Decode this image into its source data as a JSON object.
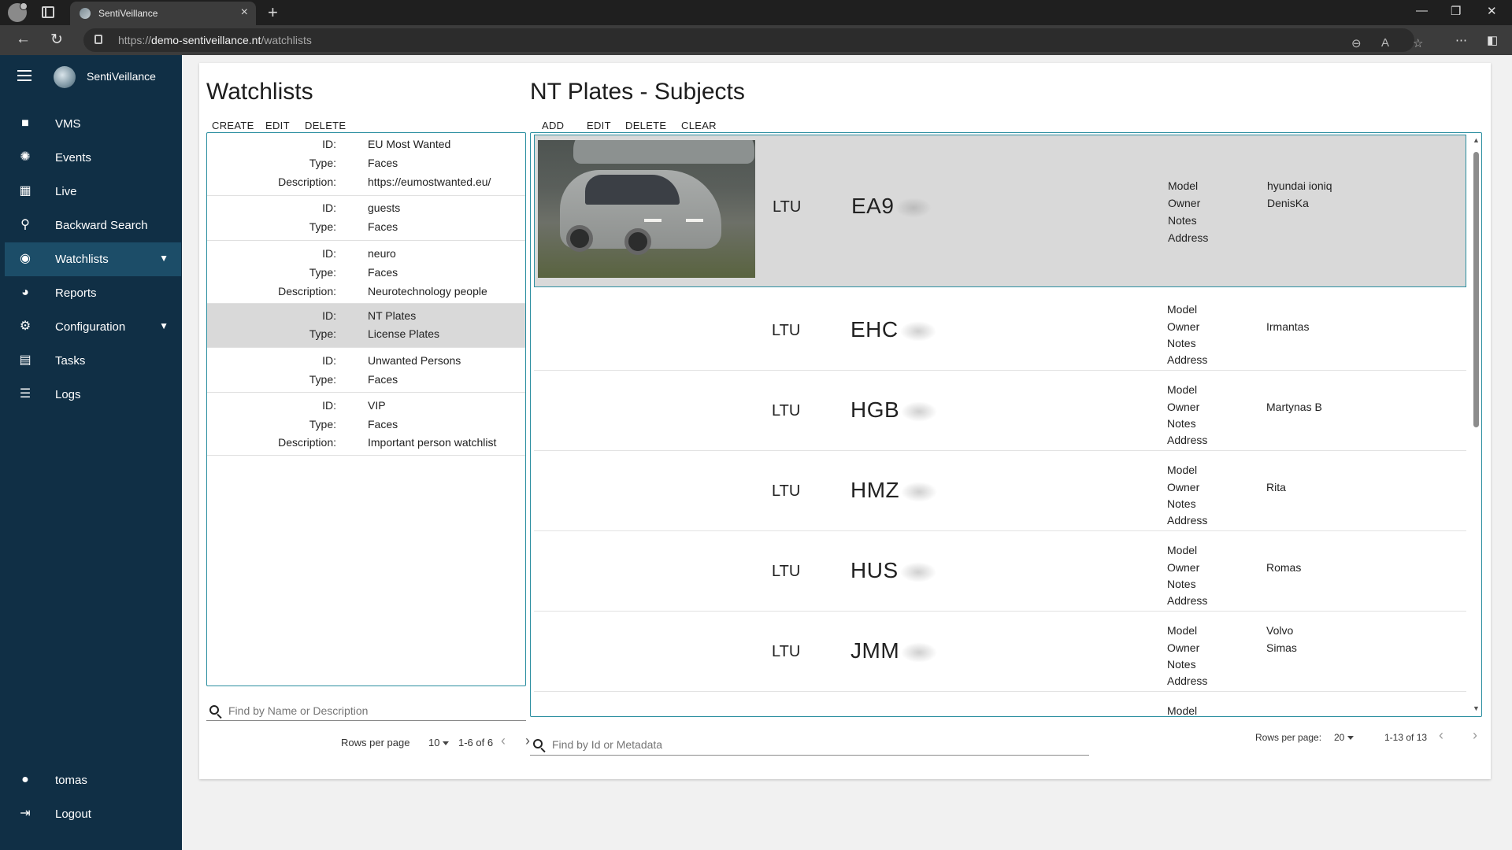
{
  "browser": {
    "tab_title": "SentiVeillance",
    "url_scheme": "https://",
    "url_host": "demo-sentiveillance.nt",
    "url_path": "/watchlists"
  },
  "app": {
    "brand": "SentiVeillance"
  },
  "sidebar": {
    "items": [
      {
        "label": "VMS",
        "icon": "video-camera-icon"
      },
      {
        "label": "Events",
        "icon": "aperture-icon"
      },
      {
        "label": "Live",
        "icon": "dashboard-icon"
      },
      {
        "label": "Backward Search",
        "icon": "search-icon"
      },
      {
        "label": "Watchlists",
        "icon": "eye-icon"
      },
      {
        "label": "Reports",
        "icon": "pie-chart-icon"
      },
      {
        "label": "Configuration",
        "icon": "gear-icon"
      },
      {
        "label": "Tasks",
        "icon": "clipboard-icon"
      },
      {
        "label": "Logs",
        "icon": "list-icon"
      }
    ],
    "user": "tomas",
    "logout": "Logout"
  },
  "watchlists": {
    "title": "Watchlists",
    "actions": {
      "create": "CREATE",
      "edit": "EDIT",
      "delete": "DELETE"
    },
    "labels": {
      "id": "ID:",
      "type": "Type:",
      "description": "Description:"
    },
    "items": [
      {
        "id": "EU Most Wanted",
        "type": "Faces",
        "description": "https://eumostwanted.eu/"
      },
      {
        "id": "guests",
        "type": "Faces"
      },
      {
        "id": "neuro",
        "type": "Faces",
        "description": "Neurotechnology people"
      },
      {
        "id": "NT Plates",
        "type": "License Plates",
        "selected": true
      },
      {
        "id": "Unwanted Persons",
        "type": "Faces"
      },
      {
        "id": "VIP",
        "type": "Faces",
        "description": "Important person watchlist"
      }
    ],
    "search_placeholder": "Find by Name or Description",
    "rows_per_page_label": "Rows per page",
    "rows_per_page": "10",
    "range": "1-6 of 6"
  },
  "subjects": {
    "title": "NT Plates - Subjects",
    "actions": {
      "add": "ADD",
      "edit": "EDIT",
      "delete": "DELETE",
      "clear": "CLEAR"
    },
    "meta_labels": {
      "model": "Model",
      "owner": "Owner",
      "notes": "Notes",
      "address": "Address"
    },
    "items": [
      {
        "country": "LTU",
        "plate": "EA9",
        "model": "hyundai ioniq",
        "owner": "DenisKa",
        "notes": "",
        "address": "",
        "has_photo": true,
        "selected": true
      },
      {
        "country": "LTU",
        "plate": "EHC",
        "model": "",
        "owner": "Irmantas",
        "notes": "",
        "address": ""
      },
      {
        "country": "LTU",
        "plate": "HGB",
        "model": "",
        "owner": "Martynas B",
        "notes": "",
        "address": ""
      },
      {
        "country": "LTU",
        "plate": "HMZ",
        "model": "",
        "owner": "Rita",
        "notes": "",
        "address": ""
      },
      {
        "country": "LTU",
        "plate": "HUS",
        "model": "",
        "owner": "Romas",
        "notes": "",
        "address": ""
      },
      {
        "country": "LTU",
        "plate": "JMM",
        "model": "Volvo",
        "owner": "Simas",
        "notes": "",
        "address": ""
      }
    ],
    "partial_next_label": "Model",
    "search_placeholder": "Find by Id or Metadata",
    "rows_per_page_label": "Rows per page:",
    "rows_per_page": "20",
    "range": "1-13 of 13"
  }
}
